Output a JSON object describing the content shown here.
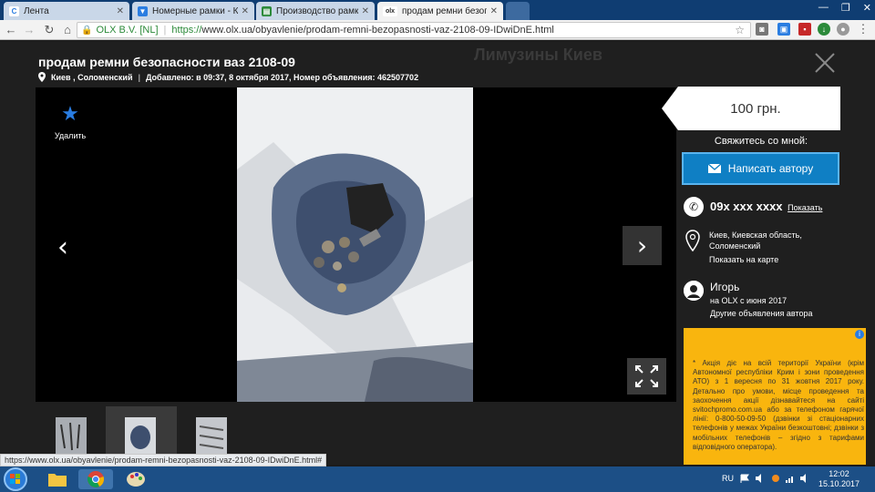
{
  "browser": {
    "tabs": [
      {
        "label": "Лента",
        "icon_color": "#2a7de1",
        "icon": "lenta-icon",
        "active": false
      },
      {
        "label": "Номерные рамки - Клу",
        "icon_color": "#2a7de1",
        "icon": "vk-icon",
        "active": false
      },
      {
        "label": "Производство рамки п",
        "icon_color": "#2c8a3a",
        "icon": "doc-icon",
        "active": false
      },
      {
        "label": "продам ремни безопас",
        "icon_color": "#2c2c2c",
        "icon": "olx-icon",
        "active": true
      }
    ],
    "site_identity": "OLX B.V. [NL]",
    "url_https": "https://",
    "url_rest": "www.olx.ua/obyavlenie/prodam-remni-bezopasnosti-vaz-2108-09-IDwiDnE.html",
    "status_url": "https://www.olx.ua/obyavlenie/prodam-remni-bezopasnosti-vaz-2108-09-IDwiDnE.html#"
  },
  "ad": {
    "title": "продам ремни безопасности ваз 2108-09",
    "location": "Киев , Соломенский",
    "meta": "Добавлено: в 09:37, 8 октября 2017, Номер объявления: 462507702",
    "background_text": "Лимузины Киев",
    "favorite_label": "Удалить"
  },
  "sidebar": {
    "price": "100 грн.",
    "contact_label": "Свяжитесь со мной:",
    "write_button": "Написать автору",
    "phone": "09x xxx xxxx",
    "phone_show": "Показать",
    "location_lines": "Киев, Киевская область, Соломенский",
    "map_link": "Показать на карте",
    "user_name": "Игорь",
    "user_since": "на OLX с июня 2017",
    "user_other_ads": "Другие объявления автора"
  },
  "promo": {
    "text": "* Акція діє на всій території України (крім Автономної республіки Крим і зони проведення АТО) з 1 вересня по 31 жовтня 2017 року. Детально про умови, місце проведення та заохочення акції дізнавайтеся на сайті svitochpromo.com.ua або за телефоном гарячої лінії: 0-800-50-09-50 (дзвінки зі стаціонарних телефонів у межах України безкоштовні; дзвінки з мобільних телефонів – згідно з тарифами відповідного оператора).",
    "color": "#f9b50e"
  },
  "taskbar": {
    "lang": "RU",
    "time": "12:02",
    "date": "15.10.2017"
  },
  "colors": {
    "accent": "#0f7fc4",
    "overlay": "#1f1f1f"
  }
}
